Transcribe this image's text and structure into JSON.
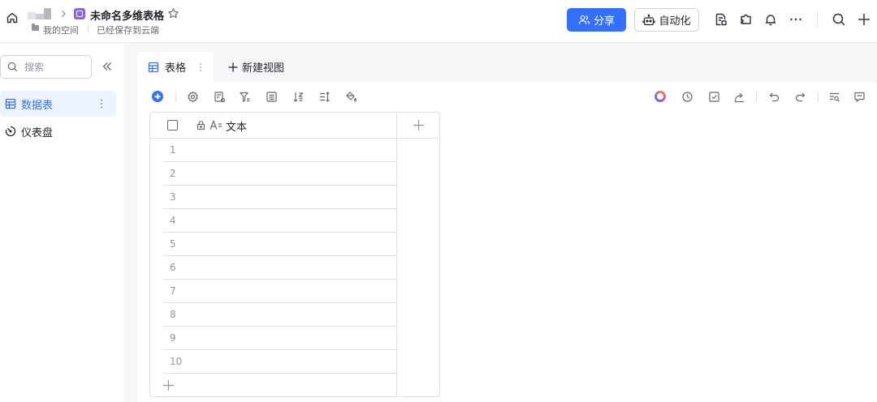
{
  "header": {
    "doc_title": "未命名多维表格",
    "space_label": "我的空间",
    "save_status": "已经保存到云端",
    "share_label": "分享",
    "automation_label": "自动化"
  },
  "sidebar": {
    "search_placeholder": "搜索",
    "items": [
      {
        "label": "数据表",
        "icon": "table-icon",
        "active": true
      },
      {
        "label": "仪表盘",
        "icon": "dashboard-icon",
        "active": false
      }
    ]
  },
  "view": {
    "tab_label": "表格",
    "new_view_label": "新建视图"
  },
  "grid": {
    "field_name": "文本",
    "row_numbers": [
      "1",
      "2",
      "3",
      "4",
      "5",
      "6",
      "7",
      "8",
      "9",
      "10"
    ]
  },
  "colors": {
    "accent": "#3370ff",
    "active_bg": "#edf2ff",
    "doc_icon": "#8a63e8"
  }
}
